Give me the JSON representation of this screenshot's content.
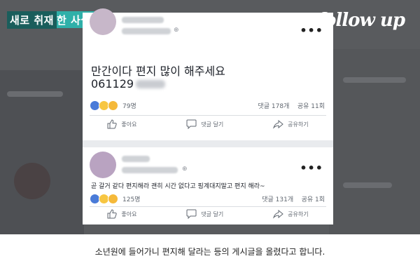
{
  "overlay": {
    "news_tag_dim": "새로 취재",
    "news_tag_rest": "한 사실",
    "logo": "follow up"
  },
  "post1": {
    "body": "만간이다 편지 많이 해주세요",
    "code": "061129",
    "reaction_count": "79명",
    "comments": "댓글 178개",
    "shares": "공유 11회",
    "like_label": "좋아요",
    "comment_label": "댓글 달기",
    "share_label": "공유하기",
    "more_icon": "more-icon"
  },
  "post2": {
    "body": "곧 갈거 같다 편지해라 괜히 시간 없다고 핑계대지말고 편지 해라~",
    "reaction_count": "125명",
    "comments": "댓글 131개",
    "shares": "공유 1회",
    "like_label": "좋아요",
    "comment_label": "댓글 달기",
    "share_label": "공유하기"
  },
  "caption": "소년원에 들어가니 편지해 달라는 등의 게시글을 올렸다고 합니다.",
  "colors": {
    "news_tag": "#2fb0a9",
    "reaction_like": "#4a7bd8",
    "reaction_haha": "#f7c642"
  }
}
